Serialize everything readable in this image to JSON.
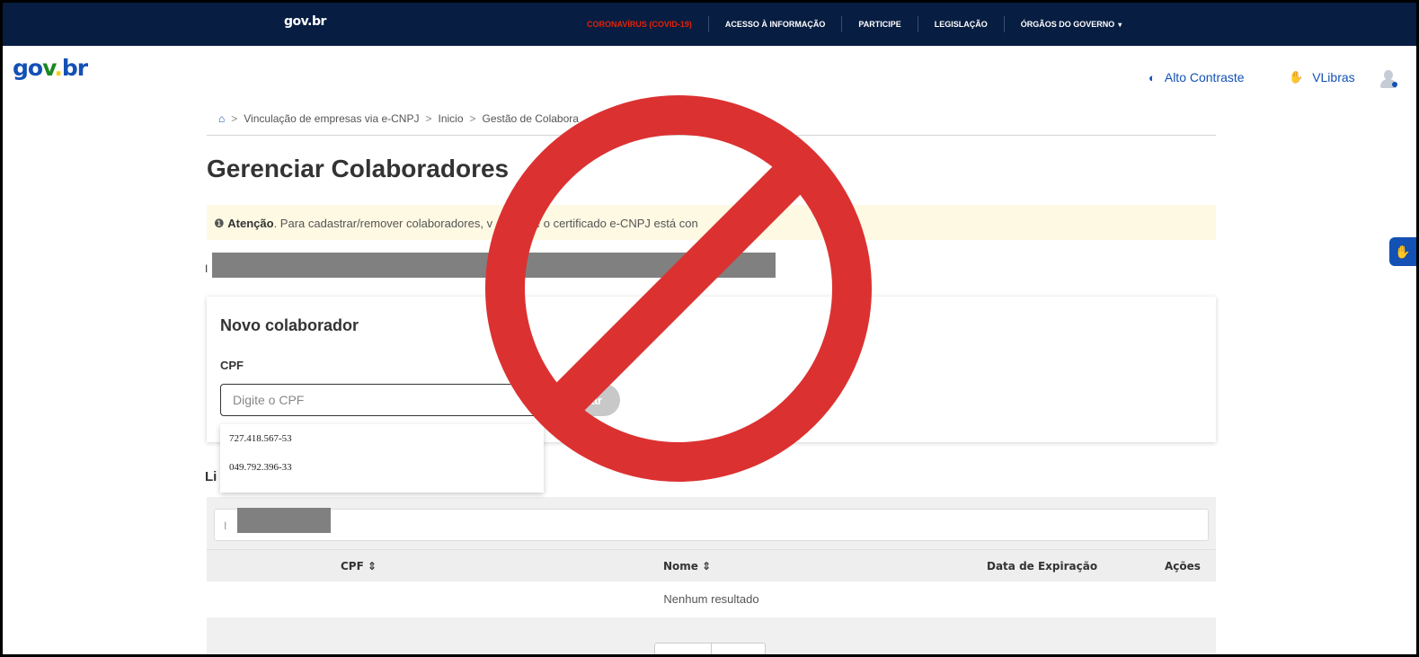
{
  "topbar": {
    "logo": "gov.br",
    "links": [
      {
        "label": "CORONAVÍRUS (COVID-19)"
      },
      {
        "label": "ACESSO À INFORMAÇÃO"
      },
      {
        "label": "PARTICIPE"
      },
      {
        "label": "LEGISLAÇÃO"
      },
      {
        "label": "ÓRGÃOS DO GOVERNO"
      }
    ],
    "colors": {
      "background": "#071d41",
      "covid": "#e52207"
    }
  },
  "header": {
    "brand": "gov.br",
    "contrast_label": "Alto Contraste",
    "vlibras_label": "VLibras",
    "icons": {
      "contrast": "half-circle-icon",
      "vlibras": "hand-icon",
      "user": "user-avatar-icon"
    }
  },
  "breadcrumb": {
    "items": [
      "Vinculação de empresas via e-CNPJ",
      "Inicio",
      "Gestão de Colabora"
    ],
    "separator": ">"
  },
  "page": {
    "title": "Gerenciar Colaboradores",
    "alert_strong": "Atenção",
    "alert_text": ". Para cadastrar/remover colaboradores, v",
    "alert_text_2": "que se o certificado e-CNPJ está con"
  },
  "form": {
    "title": "Novo colaborador",
    "cpf_label": "CPF",
    "cpf_placeholder": "Digite o CPF",
    "add_button": "ar",
    "suggestions": [
      "727.418.567-53",
      "049.792.396-33"
    ]
  },
  "list": {
    "title_fragment": "Li",
    "columns": [
      "CPF ⇕",
      "Nome ⇕",
      "Data de Expiração",
      "Ações"
    ],
    "empty_message": "Nenhum resultado"
  },
  "overlay": {
    "type": "prohibited-sign",
    "color": "#dc3131"
  }
}
